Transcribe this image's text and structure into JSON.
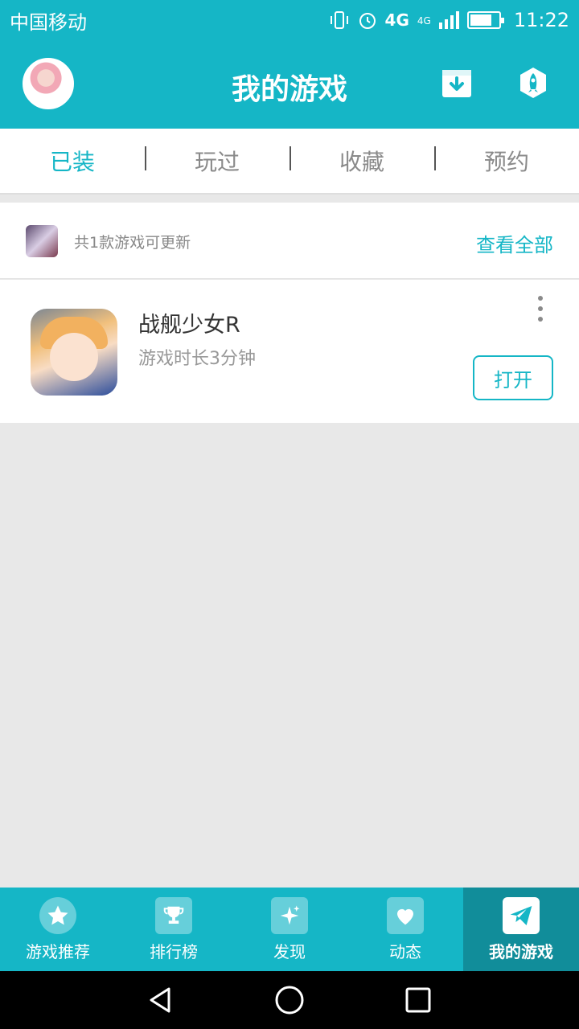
{
  "status_bar": {
    "carrier": "中国移动",
    "network_1": "4G",
    "network_2": "4G",
    "time": "11:22"
  },
  "header": {
    "title": "我的游戏"
  },
  "tabs": [
    {
      "label": "已装",
      "active": true
    },
    {
      "label": "玩过",
      "active": false
    },
    {
      "label": "收藏",
      "active": false
    },
    {
      "label": "预约",
      "active": false
    }
  ],
  "update_banner": {
    "text": "共1款游戏可更新",
    "view_all": "查看全部"
  },
  "games": [
    {
      "name": "战舰少女R",
      "playtime": "游戏时长3分钟",
      "action": "打开"
    }
  ],
  "bottom_nav": [
    {
      "label": "游戏推荐",
      "icon": "star-icon",
      "active": false
    },
    {
      "label": "排行榜",
      "icon": "trophy-icon",
      "active": false
    },
    {
      "label": "发现",
      "icon": "sparkle-icon",
      "active": false
    },
    {
      "label": "动态",
      "icon": "heart-icon",
      "active": false
    },
    {
      "label": "我的游戏",
      "icon": "paper-plane-icon",
      "active": true
    }
  ],
  "colors": {
    "accent": "#15b6c6",
    "nav_active": "#118d9a",
    "background": "#e8e8e8"
  }
}
